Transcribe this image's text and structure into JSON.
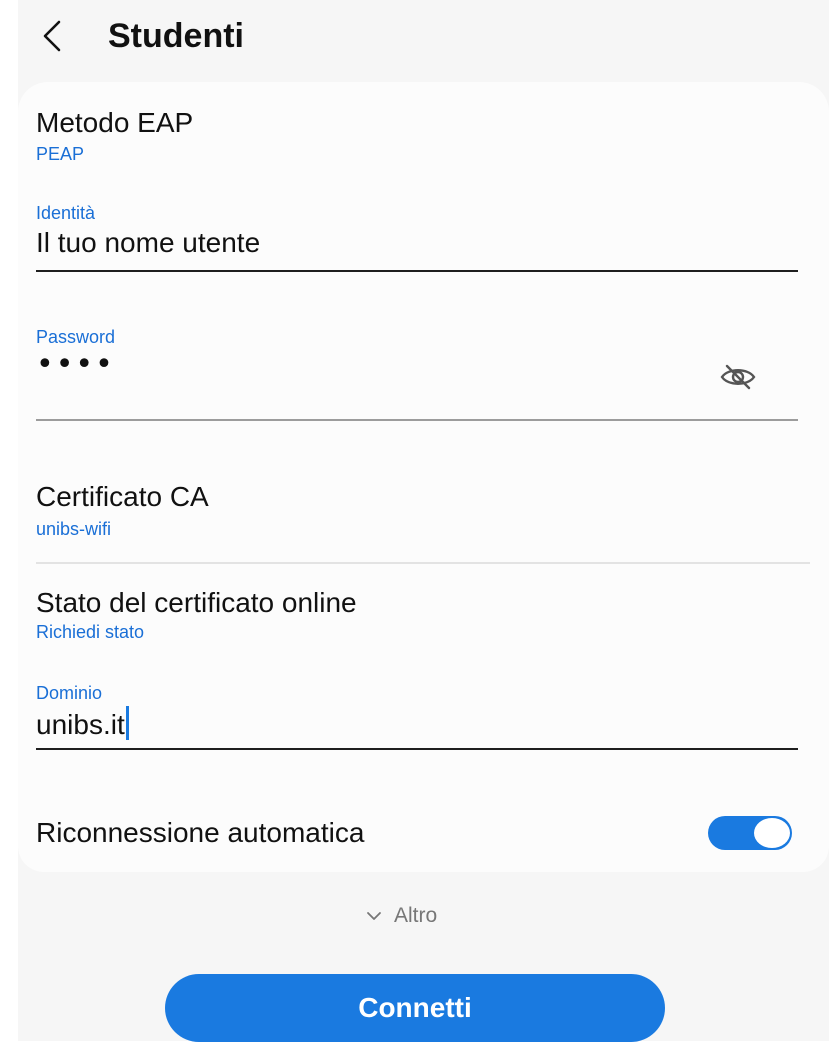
{
  "header": {
    "title": "Studenti",
    "back_icon": "chevron-left-icon"
  },
  "eap": {
    "title": "Metodo EAP",
    "value": "PEAP"
  },
  "identity": {
    "label": "Identità",
    "value": "Il tuo nome utente"
  },
  "password": {
    "label": "Password",
    "value": "••••",
    "toggle_icon": "eye-off-icon"
  },
  "ca_certificate": {
    "title": "Certificato CA",
    "value": "unibs-wifi"
  },
  "online_cert_status": {
    "title": "Stato del certificato online",
    "value": "Richiedi stato"
  },
  "domain": {
    "label": "Dominio",
    "value": "unibs.it"
  },
  "auto_reconnect": {
    "label": "Riconnessione automatica",
    "enabled": true
  },
  "more": {
    "label": "Altro",
    "icon": "chevron-down-icon"
  },
  "connect_button": {
    "label": "Connetti"
  },
  "colors": {
    "accent": "#1a7ae0",
    "link_text": "#1a6fd6",
    "background": "#f6f6f6",
    "card": "#fcfcfc"
  }
}
